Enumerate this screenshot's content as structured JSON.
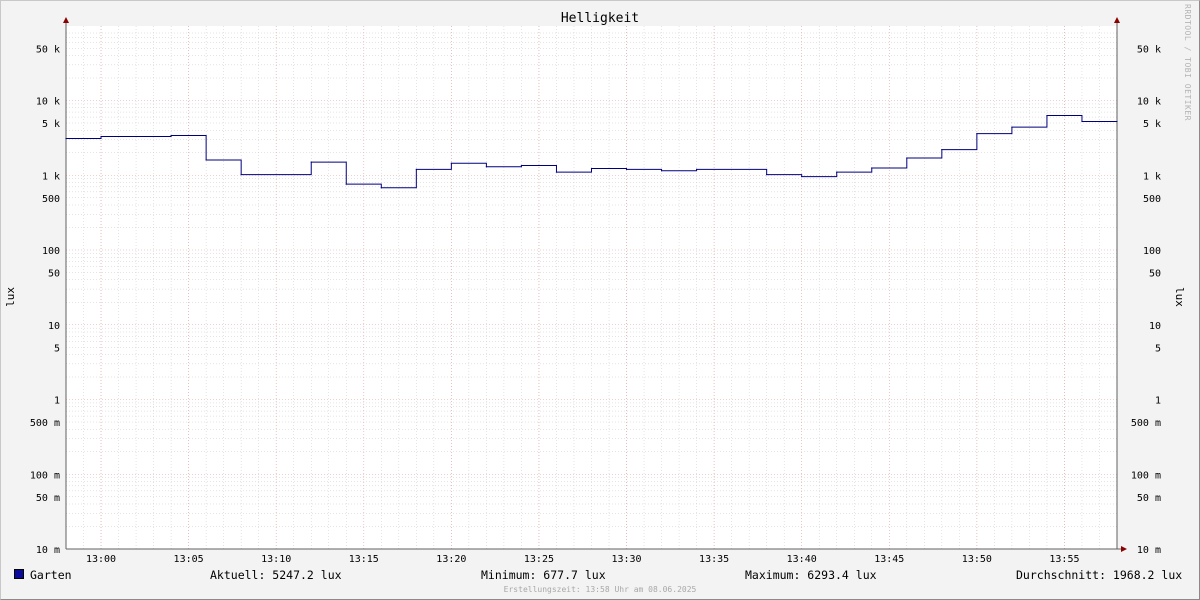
{
  "watermark": "RRDTOOL / TOBI OETIKER",
  "footer": "Erstellungszeit: 13:58 Uhr am 08.06.2025",
  "legend": {
    "series_name": "Garten",
    "aktuell": "Aktuell: 5247.2 lux",
    "minimum": "Minimum: 677.7 lux",
    "maximum": "Maximum: 6293.4 lux",
    "durchschnitt": "Durchschnitt: 1968.2 lux"
  },
  "colors": {
    "line": "#00007f",
    "swatch": "#0a0a9a",
    "major_grid": "#e6a0a0",
    "minor_grid": "#c8c8c8",
    "plot_bg": "#ffffff",
    "arrow": "#8b0000"
  },
  "chart_data": {
    "type": "line",
    "title": "Helligkeit",
    "ylabel": "lux",
    "y_scale": "log",
    "ylim": [
      0.01,
      80000
    ],
    "xlim": [
      "12:58",
      "13:58"
    ],
    "grid": true,
    "legend_placement": "bottom",
    "x_ticks": [
      "13:00",
      "13:05",
      "13:10",
      "13:15",
      "13:20",
      "13:25",
      "13:30",
      "13:35",
      "13:40",
      "13:45",
      "13:50",
      "13:55"
    ],
    "y_ticks": [
      {
        "value": 50000,
        "label": "50 k"
      },
      {
        "value": 10000,
        "label": "10 k"
      },
      {
        "value": 5000,
        "label": "5 k"
      },
      {
        "value": 1000,
        "label": "1 k"
      },
      {
        "value": 500,
        "label": "500"
      },
      {
        "value": 100,
        "label": "100"
      },
      {
        "value": 50,
        "label": "50"
      },
      {
        "value": 10,
        "label": "10"
      },
      {
        "value": 5,
        "label": "5"
      },
      {
        "value": 1,
        "label": "1"
      },
      {
        "value": 0.5,
        "label": "500 m"
      },
      {
        "value": 0.1,
        "label": "100 m"
      },
      {
        "value": 0.05,
        "label": "50 m"
      },
      {
        "value": 0.01,
        "label": "10 m"
      }
    ],
    "series": [
      {
        "name": "Garten",
        "step": true,
        "points": [
          {
            "x": "12:58",
            "y": 3100
          },
          {
            "x": "13:00",
            "y": 3300
          },
          {
            "x": "13:04",
            "y": 3400
          },
          {
            "x": "13:06",
            "y": 1600
          },
          {
            "x": "13:08",
            "y": 1020
          },
          {
            "x": "13:12",
            "y": 1500
          },
          {
            "x": "13:14",
            "y": 760
          },
          {
            "x": "13:16",
            "y": 680
          },
          {
            "x": "13:18",
            "y": 1200
          },
          {
            "x": "13:20",
            "y": 1450
          },
          {
            "x": "13:22",
            "y": 1300
          },
          {
            "x": "13:24",
            "y": 1350
          },
          {
            "x": "13:26",
            "y": 1100
          },
          {
            "x": "13:28",
            "y": 1230
          },
          {
            "x": "13:30",
            "y": 1200
          },
          {
            "x": "13:32",
            "y": 1150
          },
          {
            "x": "13:34",
            "y": 1200
          },
          {
            "x": "13:38",
            "y": 1020
          },
          {
            "x": "13:40",
            "y": 960
          },
          {
            "x": "13:42",
            "y": 1100
          },
          {
            "x": "13:44",
            "y": 1250
          },
          {
            "x": "13:46",
            "y": 1700
          },
          {
            "x": "13:48",
            "y": 2200
          },
          {
            "x": "13:50",
            "y": 3600
          },
          {
            "x": "13:52",
            "y": 4400
          },
          {
            "x": "13:54",
            "y": 6293.4
          },
          {
            "x": "13:56",
            "y": 5247.2
          },
          {
            "x": "13:58",
            "y": 5247.2
          }
        ]
      }
    ]
  }
}
